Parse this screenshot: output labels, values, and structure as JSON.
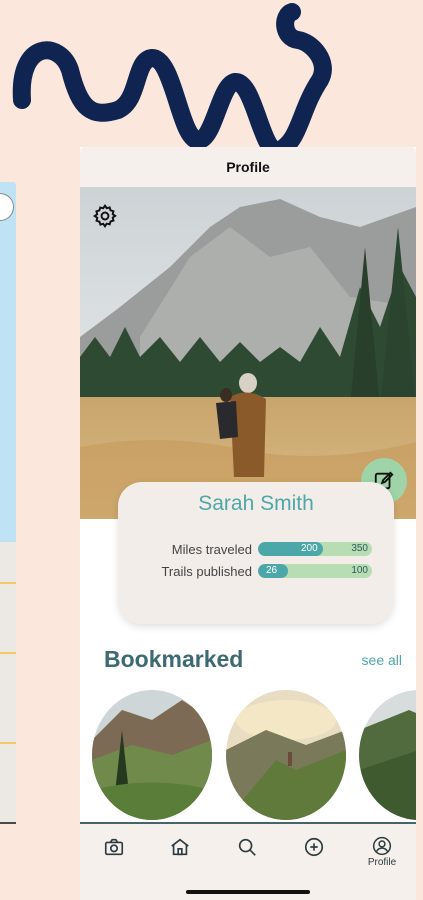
{
  "header": {
    "title": "Profile"
  },
  "profile": {
    "name": "Sarah Smith",
    "stats": [
      {
        "label": "Miles traveled",
        "current": "200",
        "max": "350",
        "fraction": 0.571
      },
      {
        "label": "Trails published",
        "current": "26",
        "max": "100",
        "fraction": 0.26
      }
    ]
  },
  "bookmarked": {
    "title": "Bookmarked",
    "see_all": "see all"
  },
  "tabs": [
    {
      "icon": "camera-icon",
      "label": ""
    },
    {
      "icon": "home-icon",
      "label": ""
    },
    {
      "icon": "search-icon",
      "label": ""
    },
    {
      "icon": "plus-circle-icon",
      "label": ""
    },
    {
      "icon": "profile-icon",
      "label": "Profile"
    }
  ],
  "colors": {
    "background": "#fbe7dc",
    "accent_teal": "#4ca8a8",
    "accent_green": "#b9ddb3",
    "edit_button": "#9fd3a8",
    "heading": "#3c6a73",
    "squiggle": "#0f2450"
  }
}
